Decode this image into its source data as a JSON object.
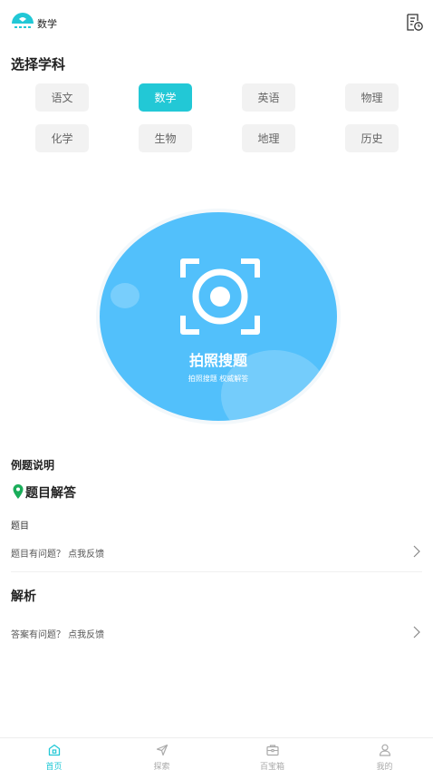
{
  "header": {
    "title": "数学",
    "logo_icon": "app-logo-icon",
    "history_icon": "history-record-icon"
  },
  "subjects": {
    "title": "选择学科",
    "items": [
      {
        "label": "语文",
        "active": false
      },
      {
        "label": "数学",
        "active": true
      },
      {
        "label": "英语",
        "active": false
      },
      {
        "label": "物理",
        "active": false
      },
      {
        "label": "化学",
        "active": false
      },
      {
        "label": "生物",
        "active": false
      },
      {
        "label": "地理",
        "active": false
      },
      {
        "label": "历史",
        "active": false
      }
    ]
  },
  "camera": {
    "title": "拍照搜题",
    "subtitle": "拍照搜题 权威解答",
    "icon": "camera-scan-icon"
  },
  "example": {
    "label": "例题说明",
    "answer_title": "题目解答",
    "question_label": "题目",
    "question_feedback": "题目有问题？ 点我反馈",
    "analysis_title": "解析",
    "answer_feedback": "答案有问题？ 点我反馈"
  },
  "tabbar": {
    "items": [
      {
        "label": "首页",
        "icon": "home-icon",
        "active": true
      },
      {
        "label": "探索",
        "icon": "explore-icon",
        "active": false
      },
      {
        "label": "百宝箱",
        "icon": "toolbox-icon",
        "active": false
      },
      {
        "label": "我的",
        "icon": "user-icon",
        "active": false
      }
    ]
  },
  "colors": {
    "accent": "#22c8d6",
    "camera_blue": "#52c0fb",
    "subject_bg": "#f2f2f2",
    "pin_green": "#1aad5a"
  }
}
